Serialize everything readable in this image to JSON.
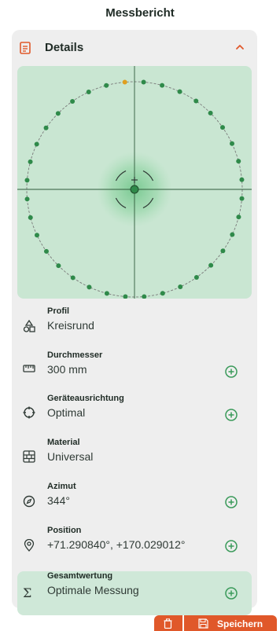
{
  "page": {
    "title": "Messbericht"
  },
  "section": {
    "title": "Details",
    "expanded": true
  },
  "plot": {
    "points_total": 36,
    "highlighted_point_index": 0,
    "colors": {
      "background": "#c9e6d2",
      "point": "#2f8a4a",
      "highlight_point": "#e0a020",
      "ring": "#7a7a7a",
      "crosshair": "#2f5a3a"
    }
  },
  "details": [
    {
      "id": "profil",
      "label": "Profil",
      "value": "Kreisrund",
      "icon": "shapes-icon",
      "addable": false
    },
    {
      "id": "durchmesser",
      "label": "Durchmesser",
      "value": "300 mm",
      "icon": "ruler-icon",
      "addable": true
    },
    {
      "id": "ausrichtung",
      "label": "Geräteausrichtung",
      "value": "Optimal",
      "icon": "crosshair-icon",
      "addable": true
    },
    {
      "id": "material",
      "label": "Material",
      "value": "Universal",
      "icon": "brick-icon",
      "addable": false
    },
    {
      "id": "azimut",
      "label": "Azimut",
      "value": "344°",
      "icon": "compass-icon",
      "addable": true
    },
    {
      "id": "position",
      "label": "Position",
      "value": "+71.290840°, +170.029012°",
      "icon": "location-pin-icon",
      "addable": true
    }
  ],
  "total": {
    "label": "Gesamtwertung",
    "value": "Optimale Messung",
    "icon": "sigma-icon"
  },
  "actions": {
    "save_label": "Speichern"
  },
  "colors": {
    "accent": "#e0582a",
    "add_icon": "#3a9a5a"
  }
}
